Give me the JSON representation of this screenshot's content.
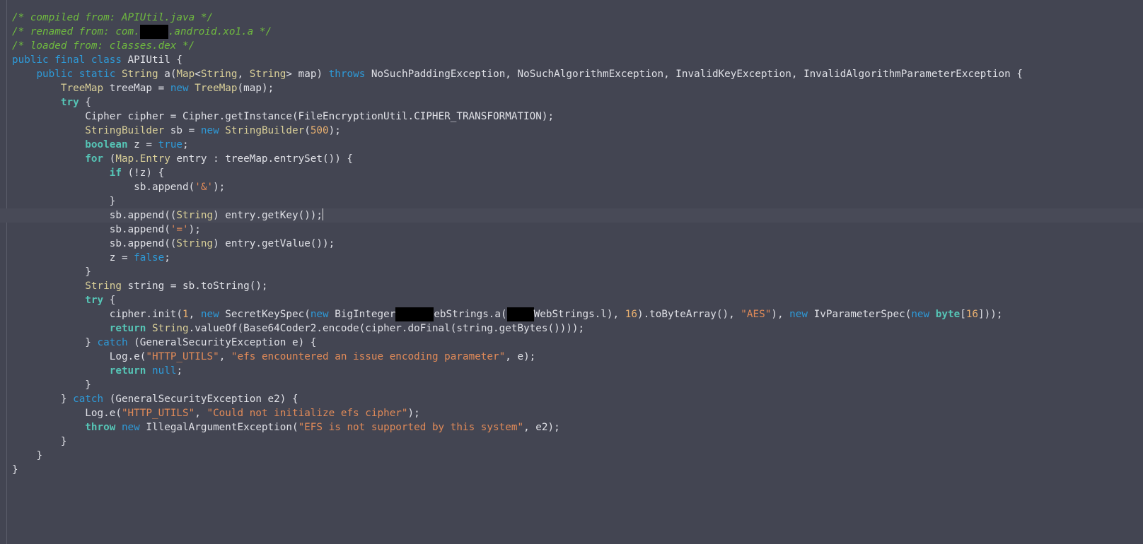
{
  "window": {
    "kind": "code-viewer",
    "theme": "dark"
  },
  "colors": {
    "background": "#434552",
    "comment": "#6fba3f",
    "keyword": "#2e9ad8",
    "keyword_bold": "#56c5b6",
    "type": "#d9cf98",
    "number": "#e9b070",
    "string": "#e08a58",
    "plain": "#dfe0e6",
    "redaction": "#000000"
  },
  "code": {
    "caret_line": 15,
    "lines": [
      {
        "indent": "",
        "tokens": [
          {
            "t": "cm",
            "v": "/* compiled from: APIUtil.java */"
          }
        ]
      },
      {
        "indent": "",
        "tokens": [
          {
            "t": "cm",
            "v": "/* renamed from: com."
          },
          {
            "t": "redact",
            "w": 40
          },
          {
            "t": "cm",
            "v": ".android.xo1.a */"
          }
        ]
      },
      {
        "indent": "",
        "tokens": [
          {
            "t": "cm",
            "v": "/* loaded from: classes.dex */"
          }
        ]
      },
      {
        "indent": "",
        "tokens": [
          {
            "t": "kw",
            "v": "public final class"
          },
          {
            "t": "pl",
            "v": " APIUtil {"
          }
        ]
      },
      {
        "indent": "    ",
        "tokens": [
          {
            "t": "kw",
            "v": "public static"
          },
          {
            "t": "pl",
            "v": " "
          },
          {
            "t": "ty",
            "v": "String"
          },
          {
            "t": "pl",
            "v": " a("
          },
          {
            "t": "ty",
            "v": "Map"
          },
          {
            "t": "pl",
            "v": "<"
          },
          {
            "t": "ty",
            "v": "String"
          },
          {
            "t": "pl",
            "v": ", "
          },
          {
            "t": "ty",
            "v": "String"
          },
          {
            "t": "pl",
            "v": "> map) "
          },
          {
            "t": "kw",
            "v": "throws"
          },
          {
            "t": "pl",
            "v": " NoSuchPaddingException, NoSuchAlgorithmException, InvalidKeyException, InvalidAlgorithmParameterException {"
          }
        ]
      },
      {
        "indent": "        ",
        "tokens": [
          {
            "t": "ty",
            "v": "TreeMap"
          },
          {
            "t": "pl",
            "v": " treeMap = "
          },
          {
            "t": "kw",
            "v": "new"
          },
          {
            "t": "pl",
            "v": " "
          },
          {
            "t": "ty",
            "v": "TreeMap"
          },
          {
            "t": "pl",
            "v": "(map);"
          }
        ]
      },
      {
        "indent": "        ",
        "tokens": [
          {
            "t": "kwb",
            "v": "try"
          },
          {
            "t": "pl",
            "v": " {"
          }
        ]
      },
      {
        "indent": "            ",
        "tokens": [
          {
            "t": "pl",
            "v": "Cipher cipher = Cipher.getInstance(FileEncryptionUtil.CIPHER_TRANSFORMATION);"
          }
        ]
      },
      {
        "indent": "            ",
        "tokens": [
          {
            "t": "ty",
            "v": "StringBuilder"
          },
          {
            "t": "pl",
            "v": " sb = "
          },
          {
            "t": "kw",
            "v": "new"
          },
          {
            "t": "pl",
            "v": " "
          },
          {
            "t": "ty",
            "v": "StringBuilder"
          },
          {
            "t": "pl",
            "v": "("
          },
          {
            "t": "num",
            "v": "500"
          },
          {
            "t": "pl",
            "v": ");"
          }
        ]
      },
      {
        "indent": "            ",
        "tokens": [
          {
            "t": "kwb",
            "v": "boolean"
          },
          {
            "t": "pl",
            "v": " z = "
          },
          {
            "t": "kw",
            "v": "true"
          },
          {
            "t": "pl",
            "v": ";"
          }
        ]
      },
      {
        "indent": "            ",
        "tokens": [
          {
            "t": "kwb",
            "v": "for"
          },
          {
            "t": "pl",
            "v": " ("
          },
          {
            "t": "ty",
            "v": "Map.Entry"
          },
          {
            "t": "pl",
            "v": " entry : treeMap.entrySet()) {"
          }
        ]
      },
      {
        "indent": "                ",
        "tokens": [
          {
            "t": "kwb",
            "v": "if"
          },
          {
            "t": "pl",
            "v": " (!z) {"
          }
        ]
      },
      {
        "indent": "                    ",
        "tokens": [
          {
            "t": "pl",
            "v": "sb.append("
          },
          {
            "t": "str",
            "v": "'&'"
          },
          {
            "t": "pl",
            "v": ");"
          }
        ]
      },
      {
        "indent": "                ",
        "tokens": [
          {
            "t": "pl",
            "v": "}"
          }
        ]
      },
      {
        "indent": "                ",
        "tokens": [
          {
            "t": "pl",
            "v": "sb.append(("
          },
          {
            "t": "ty",
            "v": "String"
          },
          {
            "t": "pl",
            "v": ") entry.getKey());"
          }
        ]
      },
      {
        "indent": "                ",
        "tokens": [
          {
            "t": "pl",
            "v": "sb.append("
          },
          {
            "t": "str",
            "v": "'='"
          },
          {
            "t": "pl",
            "v": ");"
          }
        ]
      },
      {
        "indent": "                ",
        "tokens": [
          {
            "t": "pl",
            "v": "sb.append(("
          },
          {
            "t": "ty",
            "v": "String"
          },
          {
            "t": "pl",
            "v": ") entry.getValue());"
          }
        ]
      },
      {
        "indent": "                ",
        "tokens": [
          {
            "t": "pl",
            "v": "z = "
          },
          {
            "t": "kw",
            "v": "false"
          },
          {
            "t": "pl",
            "v": ";"
          }
        ]
      },
      {
        "indent": "            ",
        "tokens": [
          {
            "t": "pl",
            "v": "}"
          }
        ]
      },
      {
        "indent": "            ",
        "tokens": [
          {
            "t": "ty",
            "v": "String"
          },
          {
            "t": "pl",
            "v": " string = sb.toString();"
          }
        ]
      },
      {
        "indent": "            ",
        "tokens": [
          {
            "t": "kwb",
            "v": "try"
          },
          {
            "t": "pl",
            "v": " {"
          }
        ]
      },
      {
        "indent": "                ",
        "tokens": [
          {
            "t": "pl",
            "v": "cipher.init("
          },
          {
            "t": "num",
            "v": "1"
          },
          {
            "t": "pl",
            "v": ", "
          },
          {
            "t": "kw",
            "v": "new"
          },
          {
            "t": "pl",
            "v": " SecretKeySpec("
          },
          {
            "t": "kw",
            "v": "new"
          },
          {
            "t": "pl",
            "v": " BigInteger"
          },
          {
            "t": "redact",
            "w": 54
          },
          {
            "t": "pl",
            "v": "ebStrings.a("
          },
          {
            "t": "redact",
            "w": 38
          },
          {
            "t": "pl",
            "v": "WebStrings.l), "
          },
          {
            "t": "num",
            "v": "16"
          },
          {
            "t": "pl",
            "v": ").toByteArray(), "
          },
          {
            "t": "str",
            "v": "\"AES\""
          },
          {
            "t": "pl",
            "v": "), "
          },
          {
            "t": "kw",
            "v": "new"
          },
          {
            "t": "pl",
            "v": " IvParameterSpec("
          },
          {
            "t": "kw",
            "v": "new"
          },
          {
            "t": "pl",
            "v": " "
          },
          {
            "t": "kwb",
            "v": "byte"
          },
          {
            "t": "pl",
            "v": "["
          },
          {
            "t": "num",
            "v": "16"
          },
          {
            "t": "pl",
            "v": "]));"
          }
        ]
      },
      {
        "indent": "                ",
        "tokens": [
          {
            "t": "kwb",
            "v": "return"
          },
          {
            "t": "pl",
            "v": " "
          },
          {
            "t": "ty",
            "v": "String"
          },
          {
            "t": "pl",
            "v": ".valueOf(Base64Coder2.encode(cipher.doFinal(string.getBytes())));"
          }
        ]
      },
      {
        "indent": "            ",
        "tokens": [
          {
            "t": "pl",
            "v": "} "
          },
          {
            "t": "kw",
            "v": "catch"
          },
          {
            "t": "pl",
            "v": " (GeneralSecurityException e) {"
          }
        ]
      },
      {
        "indent": "                ",
        "tokens": [
          {
            "t": "pl",
            "v": "Log.e("
          },
          {
            "t": "str",
            "v": "\"HTTP_UTILS\""
          },
          {
            "t": "pl",
            "v": ", "
          },
          {
            "t": "str",
            "v": "\"efs encountered an issue encoding parameter\""
          },
          {
            "t": "pl",
            "v": ", e);"
          }
        ]
      },
      {
        "indent": "                ",
        "tokens": [
          {
            "t": "kwb",
            "v": "return"
          },
          {
            "t": "pl",
            "v": " "
          },
          {
            "t": "kw",
            "v": "null"
          },
          {
            "t": "pl",
            "v": ";"
          }
        ]
      },
      {
        "indent": "            ",
        "tokens": [
          {
            "t": "pl",
            "v": "}"
          }
        ]
      },
      {
        "indent": "        ",
        "tokens": [
          {
            "t": "pl",
            "v": "} "
          },
          {
            "t": "kw",
            "v": "catch"
          },
          {
            "t": "pl",
            "v": " (GeneralSecurityException e2) {"
          }
        ]
      },
      {
        "indent": "            ",
        "tokens": [
          {
            "t": "pl",
            "v": "Log.e("
          },
          {
            "t": "str",
            "v": "\"HTTP_UTILS\""
          },
          {
            "t": "pl",
            "v": ", "
          },
          {
            "t": "str",
            "v": "\"Could not initialize efs cipher\""
          },
          {
            "t": "pl",
            "v": ");"
          }
        ]
      },
      {
        "indent": "            ",
        "tokens": [
          {
            "t": "kwb",
            "v": "throw"
          },
          {
            "t": "pl",
            "v": " "
          },
          {
            "t": "kw",
            "v": "new"
          },
          {
            "t": "pl",
            "v": " IllegalArgumentException("
          },
          {
            "t": "str",
            "v": "\"EFS is not supported by this system\""
          },
          {
            "t": "pl",
            "v": ", e2);"
          }
        ]
      },
      {
        "indent": "        ",
        "tokens": [
          {
            "t": "pl",
            "v": "}"
          }
        ]
      },
      {
        "indent": "    ",
        "tokens": [
          {
            "t": "pl",
            "v": "}"
          }
        ]
      },
      {
        "indent": "",
        "tokens": [
          {
            "t": "pl",
            "v": "}"
          }
        ]
      }
    ]
  }
}
